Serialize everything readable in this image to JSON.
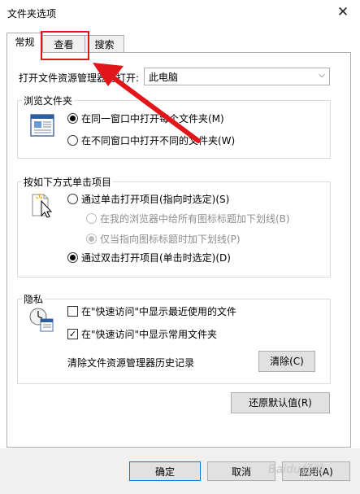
{
  "window": {
    "title": "文件夹选项",
    "close_glyph": "✕"
  },
  "tabs": [
    {
      "label": "常规",
      "active": true
    },
    {
      "label": "查看",
      "active": false
    },
    {
      "label": "搜索",
      "active": false
    }
  ],
  "open_explorer": {
    "label": "打开文件资源管理器时打开:",
    "selected": "此电脑",
    "chevron_icon": "chevron-down-icon",
    "chevron_glyph": "⌵"
  },
  "browse_folders": {
    "title": "浏览文件夹",
    "icon": "window-icon",
    "options": [
      {
        "label": "在同一窗口中打开每个文件夹(M)",
        "checked": true
      },
      {
        "label": "在不同窗口中打开不同的文件夹(W)",
        "checked": false
      }
    ]
  },
  "click_items": {
    "title": "按如下方式单击项目",
    "icon": "cursor-icon",
    "single_click": {
      "label": "通过单击打开项目(指向时选定)(S)",
      "checked": false
    },
    "underline_all": {
      "label": "在我的浏览器中给所有图标标题加下划线(B)",
      "checked": false,
      "disabled": true
    },
    "underline_hover": {
      "label": "仅当指向图标标题时加下划线(P)",
      "checked": true,
      "disabled": true
    },
    "double_click": {
      "label": "通过双击打开项目(单击时选定)(D)",
      "checked": true
    }
  },
  "privacy": {
    "title": "隐私",
    "icon": "clock-document-icon",
    "recent_files": {
      "label": "在\"快速访问\"中显示最近使用的文件",
      "checked": false
    },
    "frequent_folders": {
      "label": "在\"快速访问\"中显示常用文件夹",
      "checked": true
    },
    "clear_history_label": "清除文件资源管理器历史记录",
    "clear_button": "清除(C)",
    "check_glyph": "✓"
  },
  "restore_defaults_button": "还原默认值(R)",
  "buttons": {
    "ok": "确定",
    "cancel": "取消",
    "apply": "应用(A)"
  },
  "annotation": {
    "highlight_color": "#e0161b",
    "arrow_color": "#e0161b"
  },
  "watermark": "Baidu经验"
}
